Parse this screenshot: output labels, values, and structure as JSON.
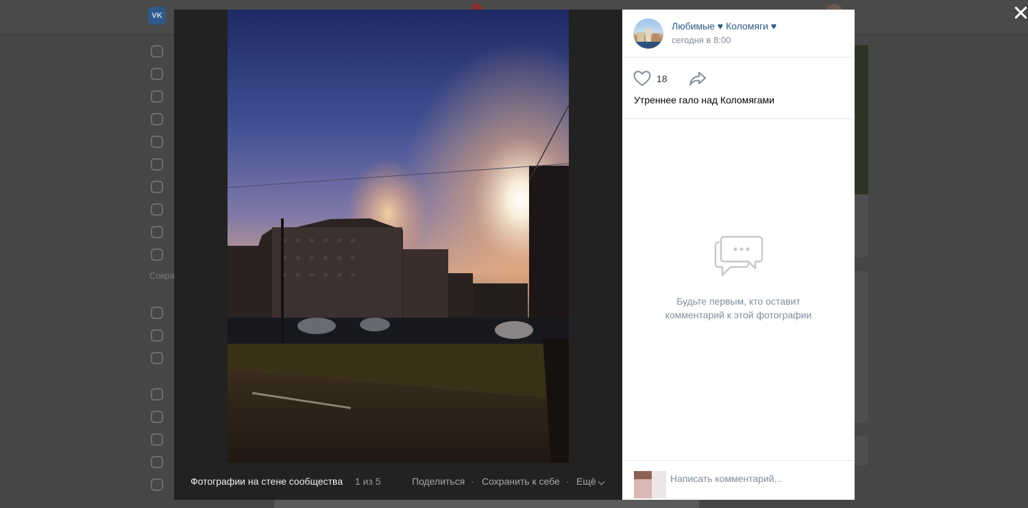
{
  "post": {
    "group_name": "Любимые ♥ Коломяги ♥",
    "time": "сегодня в 8:00",
    "likes": "18",
    "caption": "Утреннее гало над Коломягами"
  },
  "comments": {
    "empty_text": "Будьте первым, кто оставит комментарий к этой фотографии",
    "placeholder": "Написать комментарий..."
  },
  "photo_footer": {
    "album": "Фотографии на стене сообщества",
    "counter": "1 из 5",
    "share": "Поделиться",
    "save": "Сохранить к себе",
    "more": "Ещё",
    "separator": "·"
  },
  "background": {
    "logo_text": "VK",
    "left_label": "Сокра"
  },
  "icons": {
    "like": "heart-icon",
    "share": "share-arrow-icon",
    "empty": "comments-bubble-icon",
    "close": "close-icon",
    "more": "chevron-down-icon"
  },
  "colors": {
    "link": "#2a5885",
    "secondary": "#818c99",
    "overlay": "#222222"
  }
}
